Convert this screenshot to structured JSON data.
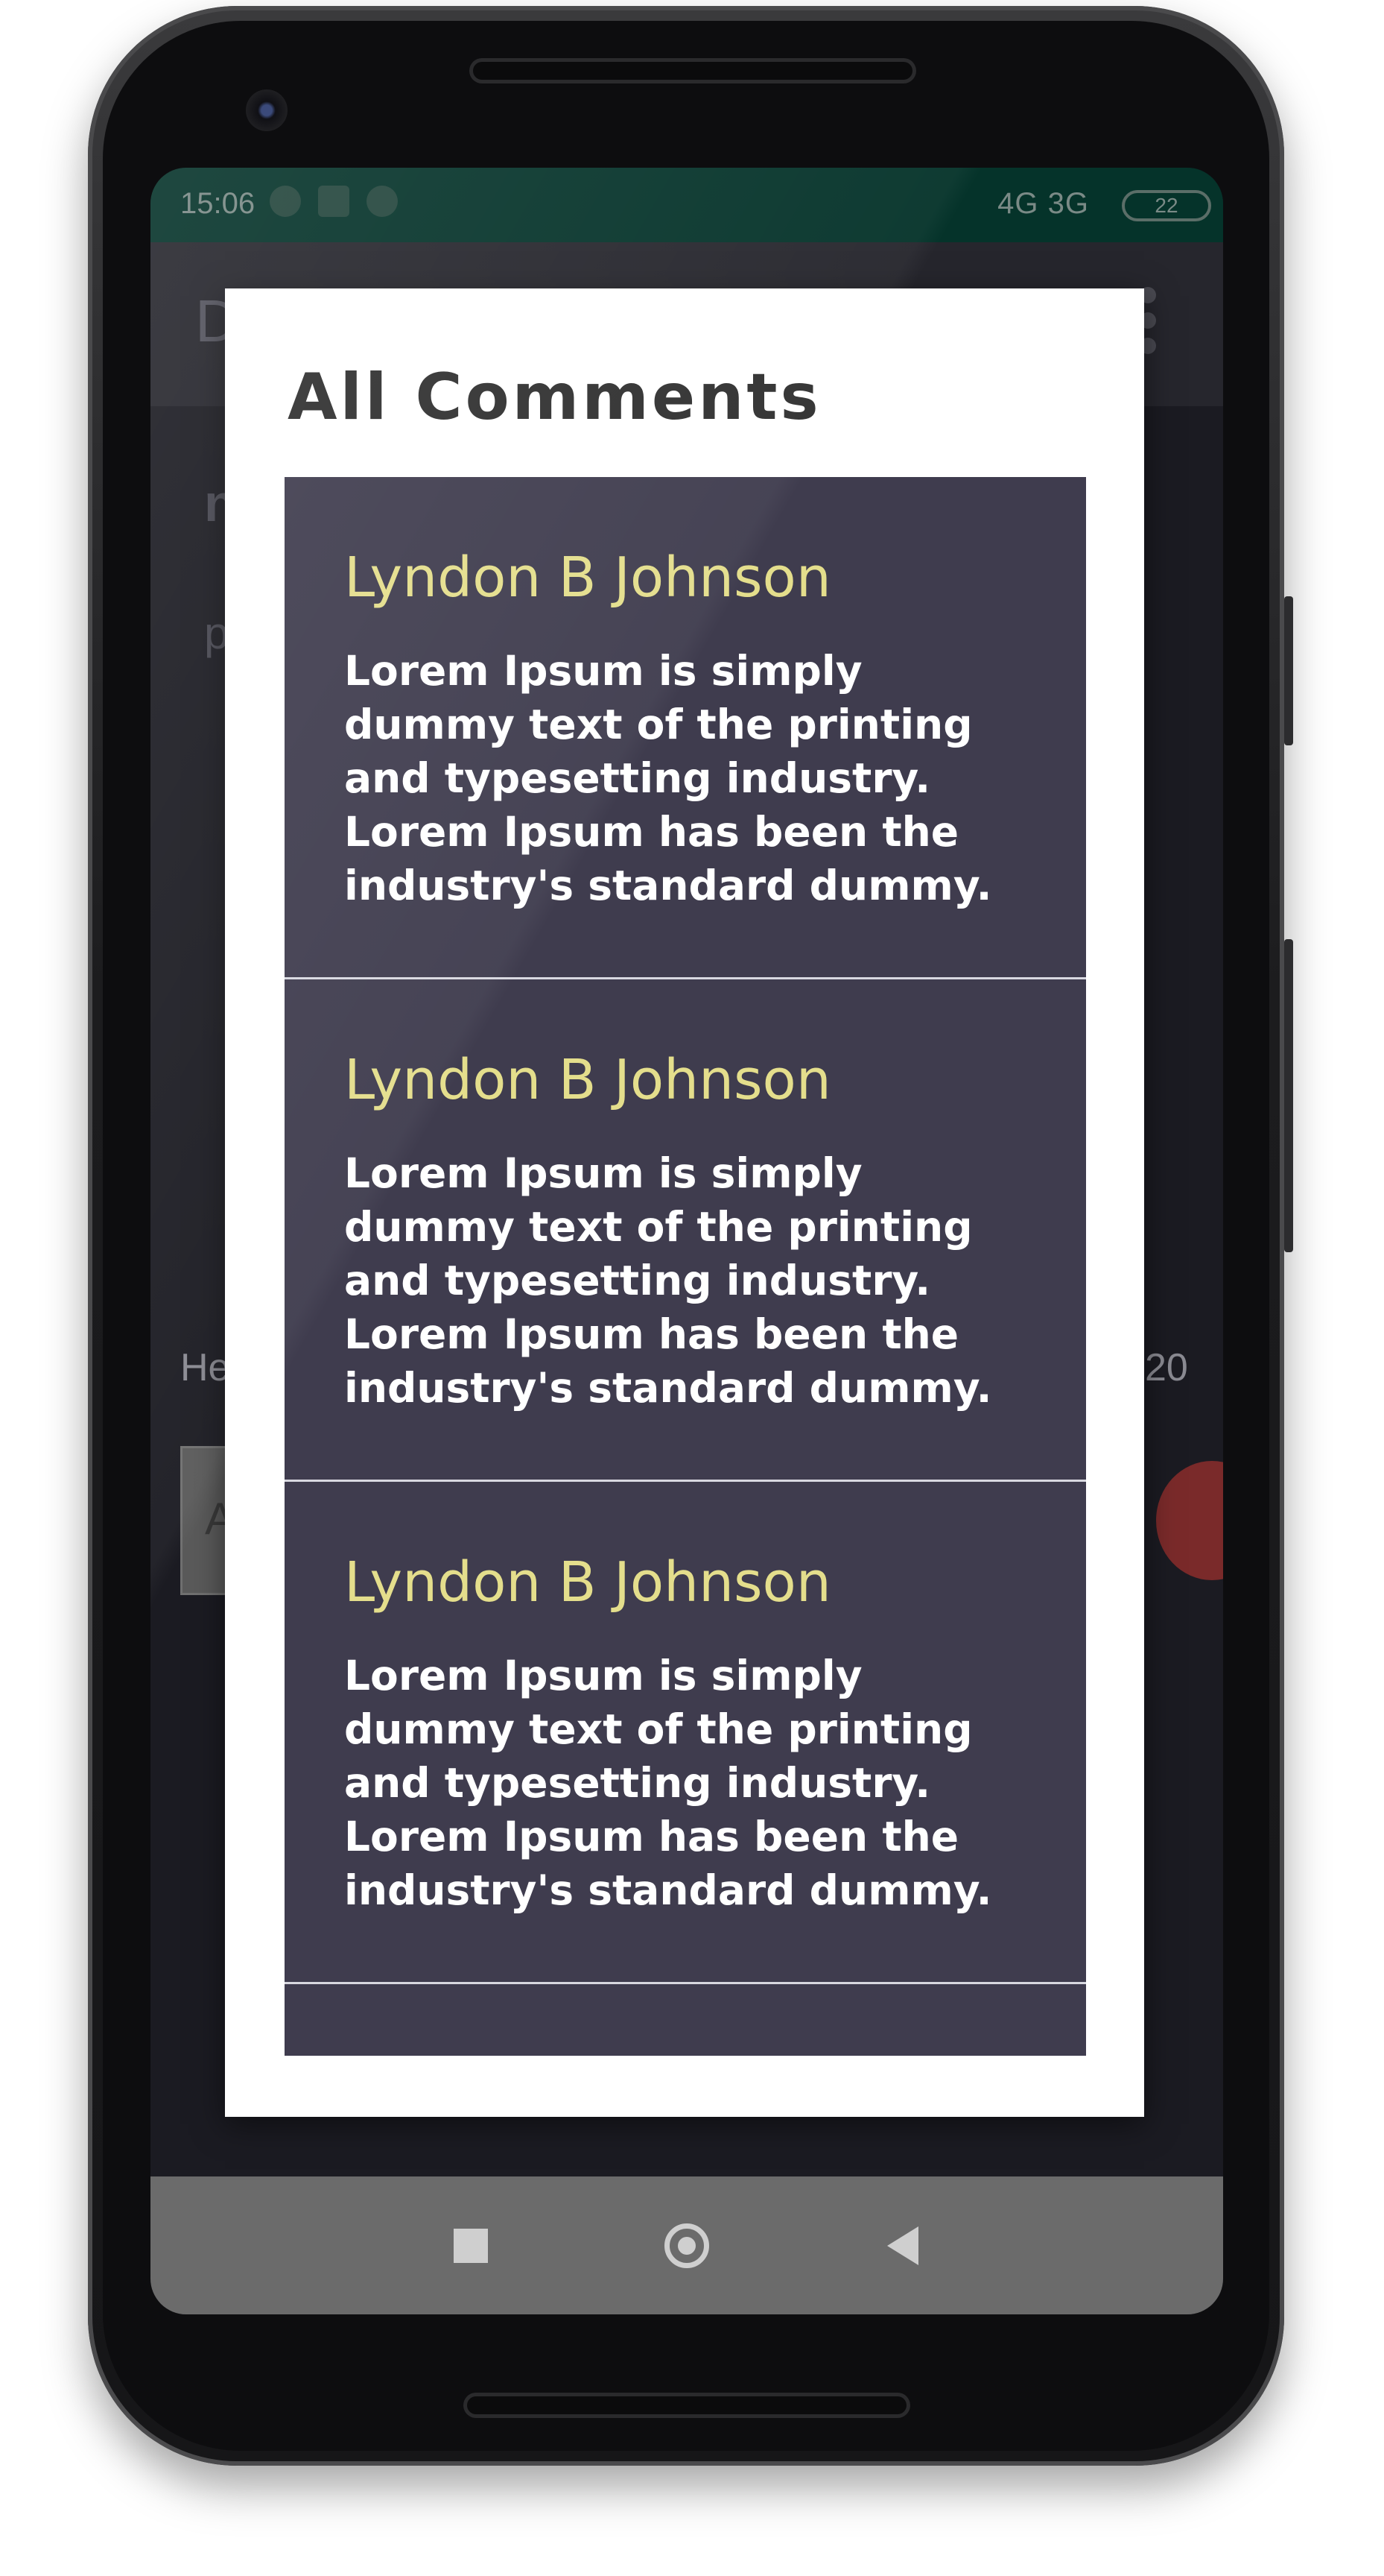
{
  "statusbar": {
    "time": "15:06",
    "network": "4G  3G",
    "battery": "22"
  },
  "background": {
    "title_fragment": "D",
    "frag1": "n",
    "frag2": "p",
    "frag3": "He",
    "frag4": "20",
    "frag5": "A"
  },
  "dialog": {
    "title": "All Comments",
    "comments": [
      {
        "author": "Lyndon B Johnson",
        "text": "Lorem Ipsum is simply dummy text of the printing and typesetting industry. Lorem Ipsum has been the industry's standard dummy."
      },
      {
        "author": "Lyndon B Johnson",
        "text": "Lorem Ipsum is simply dummy text of the printing and typesetting industry. Lorem Ipsum has been the industry's standard dummy."
      },
      {
        "author": "Lyndon B Johnson",
        "text": "Lorem Ipsum is simply dummy text of the printing and typesetting industry. Lorem Ipsum has been the industry's standard dummy."
      }
    ]
  },
  "navbar": {
    "recents_icon": "square-icon",
    "home_icon": "circle-icon",
    "back_icon": "triangle-back-icon"
  },
  "colors": {
    "author": "#e4de8c",
    "list_bg": "#3f3c4e",
    "status_bar": "#05332a"
  }
}
